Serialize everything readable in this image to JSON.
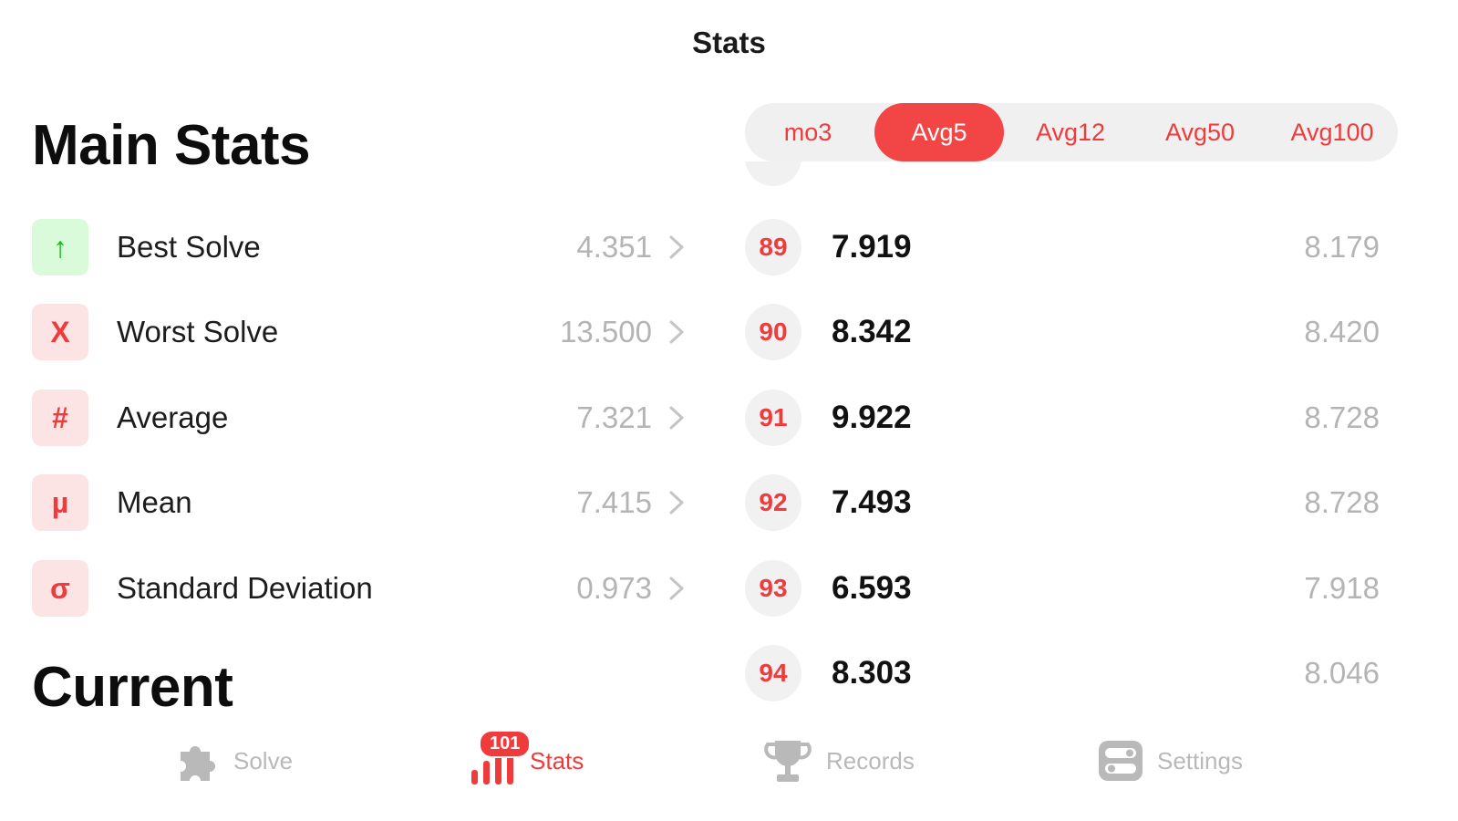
{
  "nav": {
    "title": "Stats"
  },
  "main_stats": {
    "title": "Main Stats",
    "rows": [
      {
        "icon": "arrow-up-icon",
        "glyph": "↑",
        "label": "Best Solve",
        "value": "4.351"
      },
      {
        "icon": "x-icon",
        "glyph": "X",
        "label": "Worst Solve",
        "value": "13.500"
      },
      {
        "icon": "hash-icon",
        "glyph": "#",
        "label": "Average",
        "value": "7.321"
      },
      {
        "icon": "mu-icon",
        "glyph": "µ",
        "label": "Mean",
        "value": "7.415"
      },
      {
        "icon": "sigma-icon",
        "glyph": "σ",
        "label": "Standard Deviation",
        "value": "0.973"
      }
    ]
  },
  "current": {
    "title": "Current"
  },
  "segments": {
    "items": [
      "mo3",
      "Avg5",
      "Avg12",
      "Avg50",
      "Avg100"
    ],
    "selected": "Avg5"
  },
  "solves": [
    {
      "num": "89",
      "time": "7.919",
      "avg": "8.179"
    },
    {
      "num": "90",
      "time": "8.342",
      "avg": "8.420"
    },
    {
      "num": "91",
      "time": "9.922",
      "avg": "8.728"
    },
    {
      "num": "92",
      "time": "7.493",
      "avg": "8.728"
    },
    {
      "num": "93",
      "time": "6.593",
      "avg": "7.918"
    },
    {
      "num": "94",
      "time": "8.303",
      "avg": "8.046"
    }
  ],
  "tabbar": {
    "items": [
      {
        "label": "Solve",
        "icon": "puzzle-icon"
      },
      {
        "label": "Stats",
        "icon": "bar-chart-icon",
        "badge": "101"
      },
      {
        "label": "Records",
        "icon": "trophy-icon"
      },
      {
        "label": "Settings",
        "icon": "toggle-settings-icon"
      }
    ],
    "active": "Stats"
  },
  "colors": {
    "accent": "#ef3b3b",
    "best_green": "#14b814",
    "muted": "#b4b4b4"
  }
}
